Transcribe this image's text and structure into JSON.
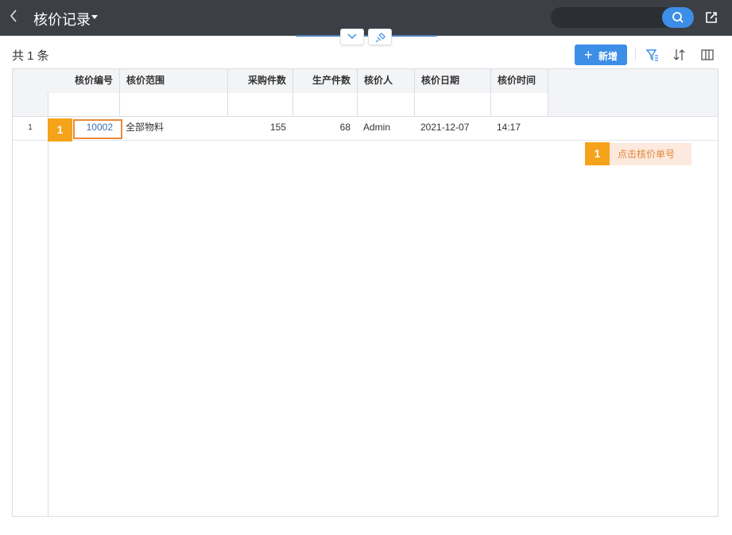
{
  "header": {
    "title": "核价记录",
    "search_placeholder": ""
  },
  "toolbar": {
    "count_text": "共 1 条",
    "add_label": "新增"
  },
  "table": {
    "columns": [
      "核价编号",
      "核价范围",
      "采购件数",
      "生产件数",
      "核价人",
      "核价日期",
      "核价时间"
    ],
    "rows": [
      {
        "index": "1",
        "code": "10002",
        "scope": "全部物料",
        "purchase_qty": "155",
        "production_qty": "68",
        "appraiser": "Admin",
        "date": "2021-12-07",
        "time": "14:17"
      }
    ]
  },
  "guide": {
    "step_number": "1",
    "tip_text": "点击核价单号"
  },
  "colors": {
    "header_bg": "#3c4046",
    "accent": "#3d8ee6",
    "highlight": "#f5a31a"
  }
}
